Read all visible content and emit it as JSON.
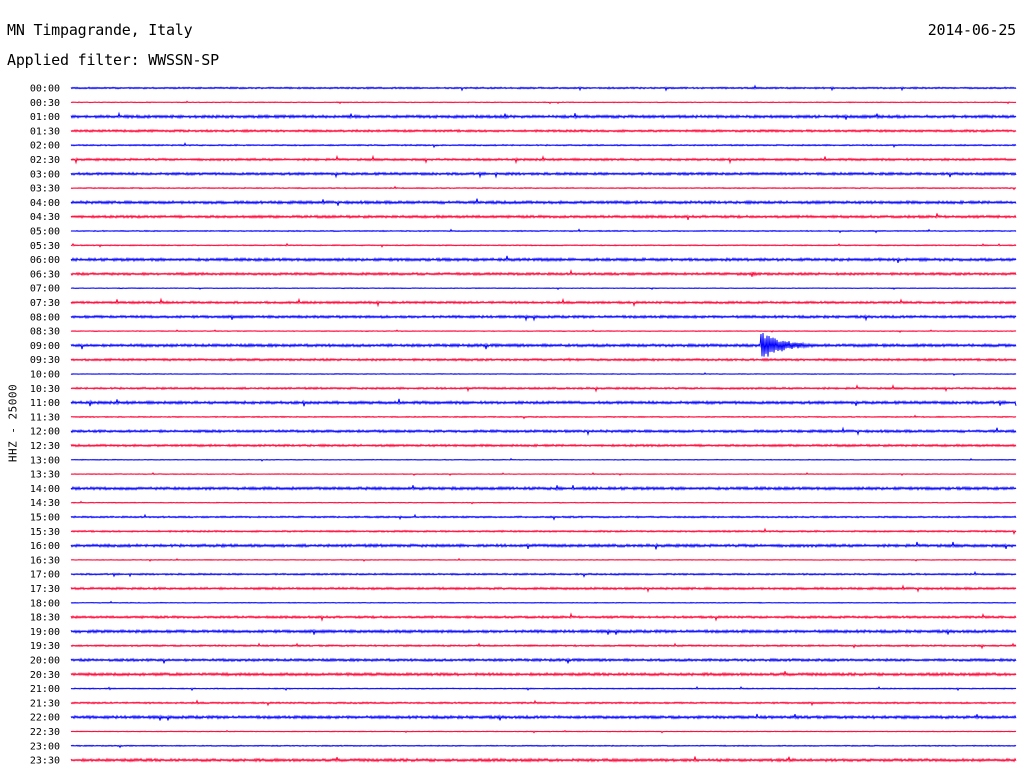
{
  "header": {
    "station": "MN Timpagrande, Italy",
    "date": "2014-06-25",
    "filter": "Applied filter: WWSSN-SP"
  },
  "channel_label": "HHZ - 25000",
  "colors": {
    "trace_a": "#0000ff",
    "trace_b": "#ff0033",
    "text": "#000000",
    "background": "#ffffff"
  },
  "chart_data": {
    "type": "line",
    "title": "",
    "ylabel": "HHZ - 25000",
    "xlabel": "",
    "y_axis": "time of day (UTC), one trace row every 30 minutes",
    "x_axis": "minutes within each 30-minute row",
    "xlim": [
      0,
      30
    ],
    "row_minutes": 30,
    "grid": false,
    "legend": "none",
    "color_cycle": [
      "#0000ff",
      "#ff0033"
    ],
    "categories": [
      "00:00",
      "00:30",
      "01:00",
      "01:30",
      "02:00",
      "02:30",
      "03:00",
      "03:30",
      "04:00",
      "04:30",
      "05:00",
      "05:30",
      "06:00",
      "06:30",
      "07:00",
      "07:30",
      "08:00",
      "08:30",
      "09:00",
      "09:30",
      "10:00",
      "10:30",
      "11:00",
      "11:30",
      "12:00",
      "12:30",
      "13:00",
      "13:30",
      "14:00",
      "14:30",
      "15:00",
      "15:30",
      "16:00",
      "16:30",
      "17:00",
      "17:30",
      "18:00",
      "18:30",
      "19:00",
      "19:30",
      "20:00",
      "20:30",
      "21:00",
      "21:30",
      "22:00",
      "22:30",
      "23:00",
      "23:30"
    ],
    "relative_noise": [
      0.6,
      0.3,
      1.0,
      0.8,
      0.5,
      0.8,
      0.9,
      0.4,
      1.0,
      0.9,
      0.4,
      0.4,
      1.0,
      0.9,
      0.3,
      0.8,
      0.9,
      0.3,
      1.0,
      0.8,
      0.3,
      0.7,
      1.0,
      0.4,
      0.9,
      0.8,
      0.3,
      0.3,
      1.0,
      0.3,
      0.6,
      0.6,
      1.0,
      0.3,
      0.6,
      0.8,
      0.3,
      0.8,
      1.0,
      0.6,
      0.9,
      1.0,
      0.4,
      0.6,
      1.0,
      0.3,
      0.4,
      1.0
    ],
    "events": [
      {
        "row": "06:30",
        "minute": 21.6,
        "amplitude": 0.25,
        "duration_min": 0.4
      },
      {
        "row": "09:00",
        "minute": 21.9,
        "amplitude": 1.0,
        "duration_min": 2.2
      },
      {
        "row": "09:30",
        "minute": 15.8,
        "amplitude": 0.15,
        "duration_min": 0.1
      },
      {
        "row": "18:30",
        "minute": 19.4,
        "amplitude": 0.15,
        "duration_min": 0.1
      },
      {
        "row": "21:00",
        "minute": 1.2,
        "amplitude": 0.12,
        "duration_min": 0.3
      }
    ]
  }
}
